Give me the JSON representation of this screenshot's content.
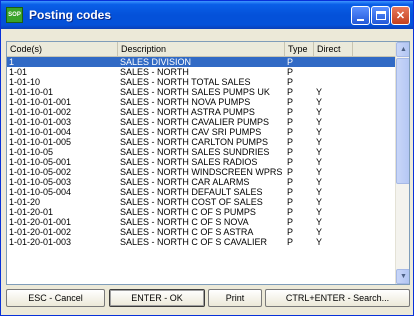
{
  "window": {
    "title": "Posting codes",
    "icon_text": "SOP",
    "close_glyph": "✕"
  },
  "table": {
    "columns": [
      "Code(s)",
      "Description",
      "Type",
      "Direct"
    ],
    "rows": [
      {
        "code": "1",
        "description": "SALES DIVISION",
        "type": "P",
        "direct": ""
      },
      {
        "code": "1-01",
        "description": "SALES - NORTH",
        "type": "P",
        "direct": ""
      },
      {
        "code": "1-01-10",
        "description": "SALES - NORTH  TOTAL SALES",
        "type": "P",
        "direct": ""
      },
      {
        "code": "1-01-10-01",
        "description": "SALES - NORTH  SALES PUMPS UK",
        "type": "P",
        "direct": "Y"
      },
      {
        "code": "1-01-10-01-001",
        "description": "SALES - NORTH  NOVA PUMPS",
        "type": "P",
        "direct": "Y"
      },
      {
        "code": "1-01-10-01-002",
        "description": "SALES - NORTH  ASTRA PUMPS",
        "type": "P",
        "direct": "Y"
      },
      {
        "code": "1-01-10-01-003",
        "description": "SALES - NORTH  CAVALIER PUMPS",
        "type": "P",
        "direct": "Y"
      },
      {
        "code": "1-01-10-01-004",
        "description": "SALES - NORTH  CAV SRI PUMPS",
        "type": "P",
        "direct": "Y"
      },
      {
        "code": "1-01-10-01-005",
        "description": "SALES - NORTH  CARLTON PUMPS",
        "type": "P",
        "direct": "Y"
      },
      {
        "code": "1-01-10-05",
        "description": "SALES - NORTH  SALES  SUNDRIES",
        "type": "P",
        "direct": "Y"
      },
      {
        "code": "1-01-10-05-001",
        "description": "SALES - NORTH  SALES RADIOS",
        "type": "P",
        "direct": "Y"
      },
      {
        "code": "1-01-10-05-002",
        "description": "SALES - NORTH  WINDSCREEN WPRS",
        "type": "P",
        "direct": "Y"
      },
      {
        "code": "1-01-10-05-003",
        "description": "SALES - NORTH  CAR ALARMS",
        "type": "P",
        "direct": "Y"
      },
      {
        "code": "1-01-10-05-004",
        "description": "SALES - NORTH  DEFAULT SALES",
        "type": "P",
        "direct": "Y"
      },
      {
        "code": "1-01-20",
        "description": "SALES - NORTH  COST OF SALES",
        "type": "P",
        "direct": "Y"
      },
      {
        "code": "1-01-20-01",
        "description": "SALES - NORTH  C OF S PUMPS",
        "type": "P",
        "direct": "Y"
      },
      {
        "code": "1-01-20-01-001",
        "description": "SALES - NORTH  C OF S NOVA",
        "type": "P",
        "direct": "Y"
      },
      {
        "code": "1-01-20-01-002",
        "description": "SALES - NORTH  C OF S ASTRA",
        "type": "P",
        "direct": "Y"
      },
      {
        "code": "1-01-20-01-003",
        "description": "SALES - NORTH  C OF S CAVALIER",
        "type": "P",
        "direct": "Y"
      }
    ]
  },
  "buttons": {
    "cancel": "ESC - Cancel",
    "ok": "ENTER - OK",
    "print": "Print",
    "search": "CTRL+ENTER - Search..."
  },
  "colors": {
    "selection": "#316ac5",
    "titlebar": "#0451d9"
  }
}
